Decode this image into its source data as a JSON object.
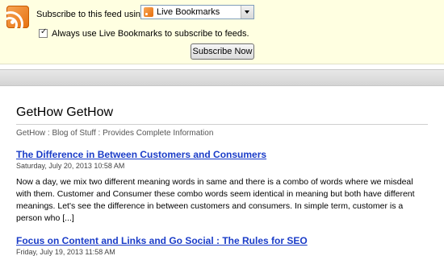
{
  "subscribe": {
    "label": "Subscribe to this feed using",
    "reader": "Live Bookmarks",
    "always_label": "Always use Live Bookmarks to subscribe to feeds.",
    "button": "Subscribe Now"
  },
  "feed": {
    "title": "GetHow GetHow",
    "subtitle": "GetHow : Blog of Stuff : Provides Complete Information",
    "items": [
      {
        "title": "The Difference in Between Customers and Consumers",
        "date": "Saturday, July 20, 2013 10:58 AM",
        "body": "Now a day, we mix two different meaning words in same and there is a combo of words where we misdeal with them. Customer and Consumer these combo words seem identical in meaning but both have different meanings. Let's see the difference in between customers and consumers. In simple term, customer is a person who [...]"
      },
      {
        "title": "Focus on Content and Links and Go Social : The Rules for SEO",
        "date": "Friday, July 19, 2013 11:58 AM"
      }
    ]
  }
}
